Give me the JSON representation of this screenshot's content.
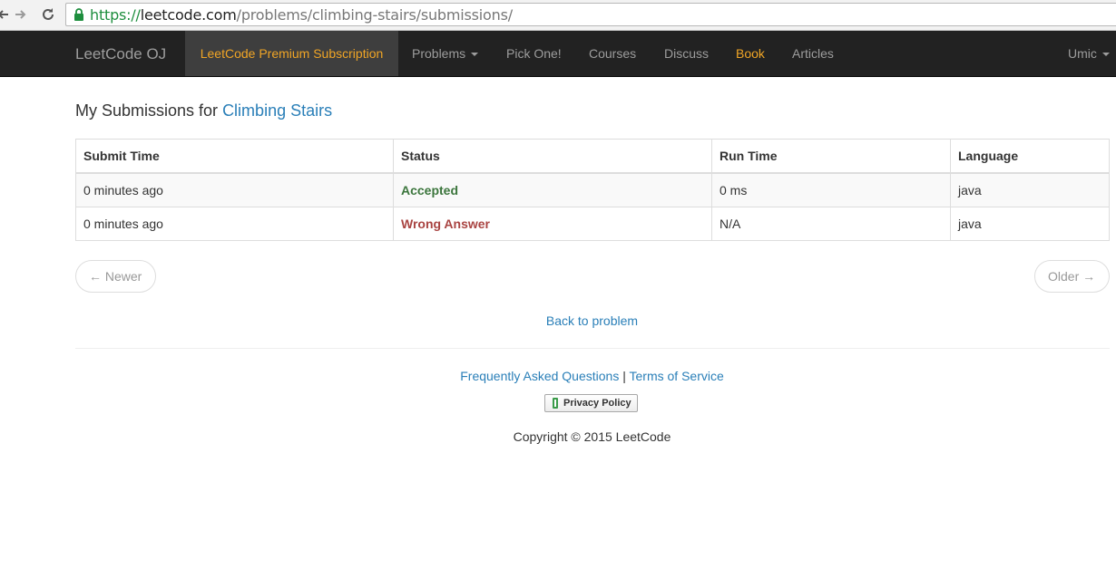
{
  "browser": {
    "url_scheme": "https://",
    "url_host": "leetcode.com",
    "url_path": "/problems/climbing-stairs/submissions/"
  },
  "navbar": {
    "brand": "LeetCode OJ",
    "items": [
      {
        "label": "LeetCode Premium Subscription"
      },
      {
        "label": "Problems"
      },
      {
        "label": "Pick One!"
      },
      {
        "label": "Courses"
      },
      {
        "label": "Discuss"
      },
      {
        "label": "Book"
      },
      {
        "label": "Articles"
      }
    ],
    "user": "Umic",
    "accent_color": "#f0a526"
  },
  "page": {
    "heading_prefix": "My Submissions for",
    "problem_title": "Climbing Stairs"
  },
  "table": {
    "columns": [
      "Submit Time",
      "Status",
      "Run Time",
      "Language"
    ],
    "rows": [
      {
        "submit_time": "0 minutes ago",
        "status": "Accepted",
        "run_time": "0 ms",
        "language": "java"
      },
      {
        "submit_time": "0 minutes ago",
        "status": "Wrong Answer",
        "run_time": "N/A",
        "language": "java"
      }
    ],
    "status_colors": {
      "accepted": "#3c763d",
      "wrong": "#a94442"
    }
  },
  "pager": {
    "newer": "← Newer",
    "older": "Older →"
  },
  "back_link": "Back to problem",
  "footer": {
    "faq": "Frequently Asked Questions",
    "separator": "|",
    "terms": "Terms of Service",
    "privacy": "Privacy Policy",
    "copyright": "Copyright © 2015 LeetCode"
  },
  "icons": [
    "back-arrow-icon",
    "forward-arrow-icon",
    "reload-icon",
    "lock-icon",
    "caret-down-icon",
    "shield-icon"
  ]
}
